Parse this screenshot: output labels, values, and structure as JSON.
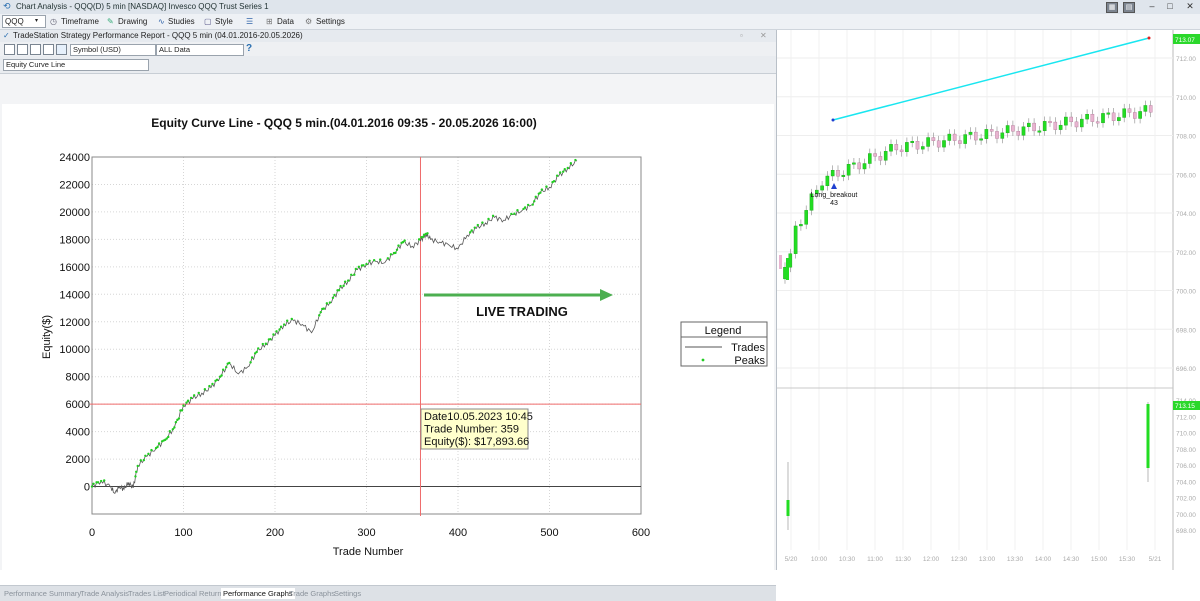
{
  "window": {
    "title": "Chart Analysis - QQQ(D) 5 min [NASDAQ] Invesco QQQ Trust Series 1",
    "controls": [
      "–",
      "□",
      "✕"
    ]
  },
  "toolbar": {
    "symbol": "QQQ",
    "timeframe": "Timeframe",
    "drawing": "Drawing",
    "studies": "Studies",
    "style": "Style",
    "data": "Data",
    "settings": "Settings"
  },
  "report": {
    "title": "TradeStation Strategy Performance Report - QQQ 5 min (04.01.2016-20.05.2026)",
    "currency_select": "Symbol (USD)",
    "data_select": "ALL Data",
    "help": "?",
    "graph_type": "Equity Curve Line",
    "tabs": [
      "Performance Summary",
      "Trade Analysis",
      "Trades List",
      "Periodical Returns",
      "Performance Graphs",
      "Trade Graphs",
      "Settings"
    ],
    "active_tab": "Performance Graphs"
  },
  "chart_data": [
    {
      "type": "line",
      "title": "Equity Curve Line - QQQ 5 min.(04.01.2016 09:35 - 20.05.2026 16:00)",
      "xlabel": "Trade Number",
      "ylabel": "Equity($)",
      "xlim": [
        0,
        600
      ],
      "ylim": [
        -2000,
        24000
      ],
      "x_ticks": [
        "0",
        "100",
        "200",
        "300",
        "400",
        "500",
        "600"
      ],
      "y_ticks": [
        "0",
        "2000",
        "4000",
        "6000",
        "8000",
        "10000",
        "12000",
        "14000",
        "16000",
        "18000",
        "20000",
        "22000",
        "24000"
      ],
      "grid": true,
      "legend": {
        "title": "Legend",
        "placement": "right",
        "entries": [
          "Trades",
          "Peaks"
        ]
      },
      "series": [
        {
          "name": "Trades",
          "color": "#555555",
          "x": [
            0,
            10,
            20,
            25,
            30,
            35,
            40,
            45,
            50,
            60,
            70,
            80,
            90,
            100,
            110,
            120,
            130,
            140,
            150,
            160,
            170,
            180,
            190,
            200,
            210,
            220,
            230,
            240,
            250,
            260,
            270,
            280,
            290,
            300,
            310,
            320,
            330,
            340,
            350,
            359,
            365,
            370,
            380,
            390,
            400,
            410,
            420,
            430,
            440,
            450,
            460,
            470,
            480,
            490,
            500,
            510,
            520,
            530
          ],
          "y": [
            0,
            400,
            0,
            -500,
            0,
            -200,
            300,
            -100,
            1500,
            2200,
            2800,
            3400,
            4300,
            5900,
            6400,
            6800,
            7200,
            8000,
            9000,
            8200,
            8700,
            9800,
            10400,
            11000,
            11800,
            12100,
            11800,
            11200,
            12700,
            13400,
            14300,
            15000,
            15800,
            16200,
            16400,
            16300,
            17000,
            17800,
            17500,
            17900,
            18400,
            18000,
            17800,
            17600,
            17300,
            18300,
            18800,
            19200,
            19600,
            19400,
            19800,
            20100,
            20500,
            21400,
            21800,
            22600,
            23200,
            23700
          ]
        },
        {
          "name": "Peaks",
          "color": "#22cc22",
          "marker": "dot"
        }
      ],
      "annotations": {
        "crosshair": {
          "x": 359,
          "y": 6000
        },
        "tooltip": [
          "Date10.05.2023 10:45",
          "Trade Number: 359",
          "Equity($): $17,893.66"
        ],
        "live_label": "LIVE TRADING"
      }
    },
    {
      "type": "candlestick",
      "x_ticks": [
        "5/20",
        "10:00",
        "10:30",
        "11:00",
        "11:30",
        "12:00",
        "12:30",
        "13:00",
        "13:30",
        "14:00",
        "14:30",
        "15:00",
        "15:30",
        "5/21"
      ],
      "y_ticks": [
        "712.00",
        "710.00",
        "708.00",
        "706.00",
        "704.00",
        "702.00",
        "700.00",
        "698.00",
        "696.00"
      ],
      "price_label": "713.07",
      "signal": {
        "label": "Long_breakout",
        "count": "43"
      },
      "volume_ticks": [
        "714.00",
        "712.00",
        "710.00",
        "708.00",
        "706.00",
        "704.00",
        "702.00",
        "700.00",
        "698.00"
      ],
      "volume_label": "713.15"
    }
  ]
}
